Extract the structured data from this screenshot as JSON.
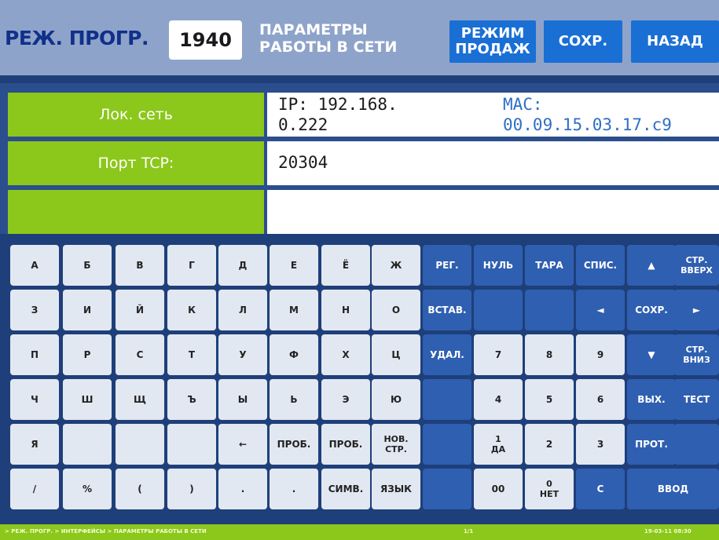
{
  "header": {
    "mode_title": "РЕЖ. ПРОГР.",
    "program_number": "1940",
    "screen_title": "ПАРАМЕТРЫ\nРАБОТЫ В СЕТИ",
    "sales_mode_label": "РЕЖИМ\nПРОДАЖ",
    "save_label": "СОХР.",
    "back_label": "НАЗАД"
  },
  "fields": {
    "lan_label": "Лок. сеть",
    "ip_value": "IP: 192.168.\n0.222",
    "mac_value": "MAC:\n00.09.15.03.17.c9",
    "tcp_port_label": "Порт TCP:",
    "tcp_port_value": "20304",
    "empty_label": "",
    "empty_value": ""
  },
  "keyboard": {
    "rows": [
      [
        "А",
        "Б",
        "В",
        "Г",
        "Д",
        "Е",
        "Ё",
        "Ж",
        "РЕГ.",
        "НУЛЬ",
        "ТАРА",
        "СПИС.",
        "▲",
        "СТР.\nВВЕРХ"
      ],
      [
        "З",
        "И",
        "Й",
        "К",
        "Л",
        "М",
        "Н",
        "О",
        "ВСТАВ.",
        "",
        "",
        "◄",
        "СОХР.",
        "►"
      ],
      [
        "П",
        "Р",
        "С",
        "Т",
        "У",
        "Ф",
        "Х",
        "Ц",
        "УДАЛ.",
        "7",
        "8",
        "9",
        "▼",
        "СТР.\nВНИЗ"
      ],
      [
        "Ч",
        "Ш",
        "Щ",
        "Ъ",
        "Ы",
        "Ь",
        "Э",
        "Ю",
        "",
        "4",
        "5",
        "6",
        "ВЫХ.",
        "ТЕСТ"
      ],
      [
        "Я",
        "",
        "",
        "",
        "←",
        "ПРОБ.",
        "ПРОБ.",
        "НОВ.\nСТР.",
        "",
        "1\nДА",
        "2",
        "3",
        "ПРОТ.",
        ""
      ],
      [
        "/",
        "%",
        "(",
        ")",
        ".",
        ".",
        "СИМВ.",
        "ЯЗЫК",
        "",
        "00",
        "0\nНЕТ",
        "С",
        "ВВОД"
      ]
    ]
  },
  "status_bar": {
    "path": "> РЕЖ. ПРОГР. > ИНТЕРФЕЙСЫ > ПАРАМЕТРЫ РАБОТЫ В СЕТИ",
    "page": "1/1",
    "datetime": "19-03-11 08:30"
  }
}
